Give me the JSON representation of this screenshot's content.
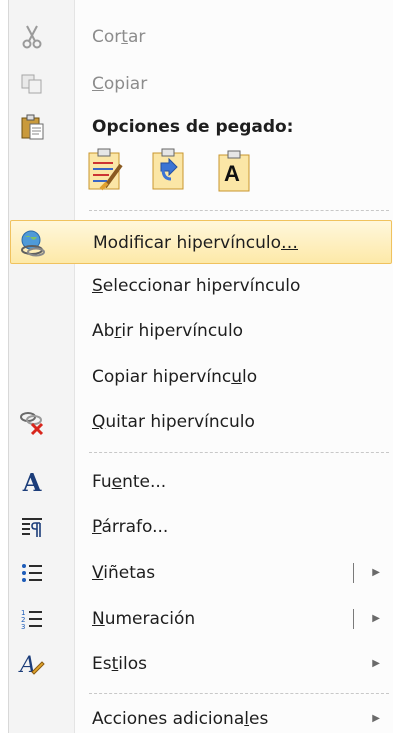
{
  "menu": {
    "cut": {
      "pre": "Cor",
      "u": "t",
      "post": "ar",
      "icon": "scissors-icon"
    },
    "copy": {
      "pre": "",
      "u": "C",
      "post": "opiar",
      "icon": "copy-icon"
    },
    "paste_header": {
      "label": "Opciones de pegado:",
      "icon": "clipboard-icon"
    },
    "paste_options": [
      {
        "icon": "paste-keep-formatting-icon"
      },
      {
        "icon": "paste-merge-formatting-icon"
      },
      {
        "icon": "paste-text-only-icon",
        "glyph": "A"
      }
    ],
    "edit_link": {
      "pre": "Modificar hipervínculo",
      "u": "…",
      "post": "",
      "icon": "edit-hyperlink-icon"
    },
    "select_link": {
      "pre": "",
      "u": "S",
      "post": "eleccionar hipervínculo"
    },
    "open_link": {
      "pre": "Ab",
      "u": "r",
      "post": "ir hipervínculo"
    },
    "copy_link": {
      "pre": "Copiar hipervínc",
      "u": "u",
      "post": "lo"
    },
    "remove_link": {
      "pre": "",
      "u": "Q",
      "post": "uitar hipervínculo",
      "icon": "remove-hyperlink-icon"
    },
    "font": {
      "pre": "Fu",
      "u": "e",
      "post": "nte...",
      "icon": "font-icon",
      "glyph": "A"
    },
    "paragraph": {
      "pre": "",
      "u": "P",
      "post": "árrafo...",
      "icon": "paragraph-icon"
    },
    "bullets": {
      "pre": "",
      "u": "V",
      "post": "iñetas",
      "icon": "bullets-icon",
      "arrow": "▶"
    },
    "numbering": {
      "pre": "",
      "u": "N",
      "post": "umeración",
      "icon": "numbering-icon",
      "arrow": "▶"
    },
    "styles": {
      "pre": "Es",
      "u": "t",
      "post": "ilos",
      "icon": "styles-icon",
      "arrow": "▶"
    },
    "more_actions": {
      "pre": "Acciones adiciona",
      "u": "l",
      "post": "es",
      "arrow": "▶"
    }
  },
  "colors": {
    "hover_border": "#f0c25e",
    "hover_fill": "#fde9a8",
    "disabled_text": "#8c8c8c"
  }
}
